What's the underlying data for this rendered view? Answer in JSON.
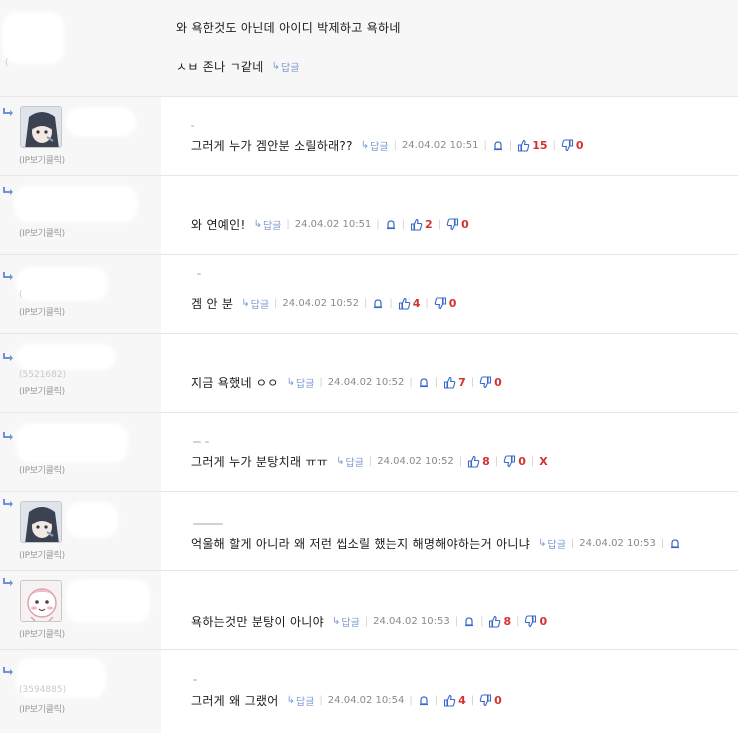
{
  "labels": {
    "reply": "답글",
    "ip_view": "(IP보기클릭)"
  },
  "colors": {
    "reply_link": "#7a9ad2",
    "count": "#d43131",
    "icon_blue": "#3a67c9"
  },
  "parent_comment": {
    "line1": "와 욕한것도 아닌데 아이디 박제하고 욕하네",
    "line2": "ㅅㅂ 존나 ㄱ같네"
  },
  "comments": [
    {
      "text": "그러게 누가 겜안분 소릴하래??",
      "date": "24.04.02 10:51",
      "up": "15",
      "down": "0",
      "avatar": "anime-dark-hair"
    },
    {
      "text": "와 연예인!",
      "date": "24.04.02 10:51",
      "up": "2",
      "down": "0"
    },
    {
      "text": "겜 안 분",
      "date": "24.04.02 10:52",
      "up": "4",
      "down": "0"
    },
    {
      "text": "지금 욕했네 ㅇㅇ",
      "date": "24.04.02 10:52",
      "up": "7",
      "down": "0",
      "faint_id": "(5521682)"
    },
    {
      "text": "그러게 누가 분탕치래 ㅠㅠ",
      "date": "24.04.02 10:52",
      "up": "8",
      "down": "0",
      "delete_label": "X"
    },
    {
      "text": "억울해 할게 아니라 왜 저런 씹소릴 했는지 해명해야하는거 아니냐",
      "date": "24.04.02 10:53",
      "avatar": "anime-dark-hair"
    },
    {
      "text": "욕하는것만 분탕이 아니야",
      "date": "24.04.02 10:53",
      "up": "8",
      "down": "0",
      "avatar": "pink-mascot"
    },
    {
      "text": "그러게 왜 그랬어",
      "date": "24.04.02 10:54",
      "up": "4",
      "down": "0",
      "faint_id": "(3594885)"
    }
  ]
}
